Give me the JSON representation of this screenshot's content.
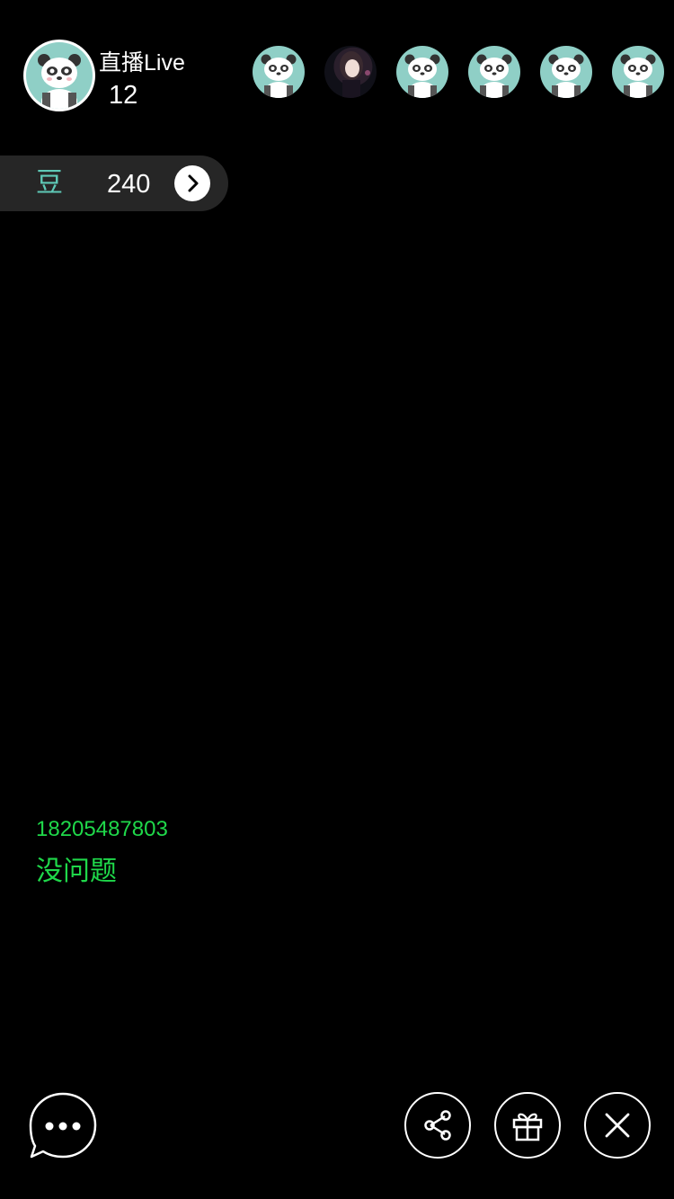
{
  "host": {
    "title": "直播Live",
    "count": "12",
    "avatar_icon": "panda-avatar-icon"
  },
  "viewers": [
    {
      "icon": "panda-avatar-icon"
    },
    {
      "icon": "user-photo-avatar"
    },
    {
      "icon": "panda-avatar-icon"
    },
    {
      "icon": "panda-avatar-icon"
    },
    {
      "icon": "panda-avatar-icon"
    },
    {
      "icon": "panda-avatar-icon"
    }
  ],
  "beans": {
    "label": "豆",
    "count": "240",
    "arrow_icon": "chevron-right-icon"
  },
  "chat": {
    "username": "18205487803",
    "message": "没问题"
  },
  "toolbar": {
    "chat_icon": "chat-bubble-icon",
    "share_icon": "share-icon",
    "gift_icon": "gift-icon",
    "close_icon": "close-icon"
  },
  "colors": {
    "background": "#000000",
    "accent_teal": "#5fc9b7",
    "chat_green": "#1fd84a",
    "pill_bg": "#262626"
  }
}
